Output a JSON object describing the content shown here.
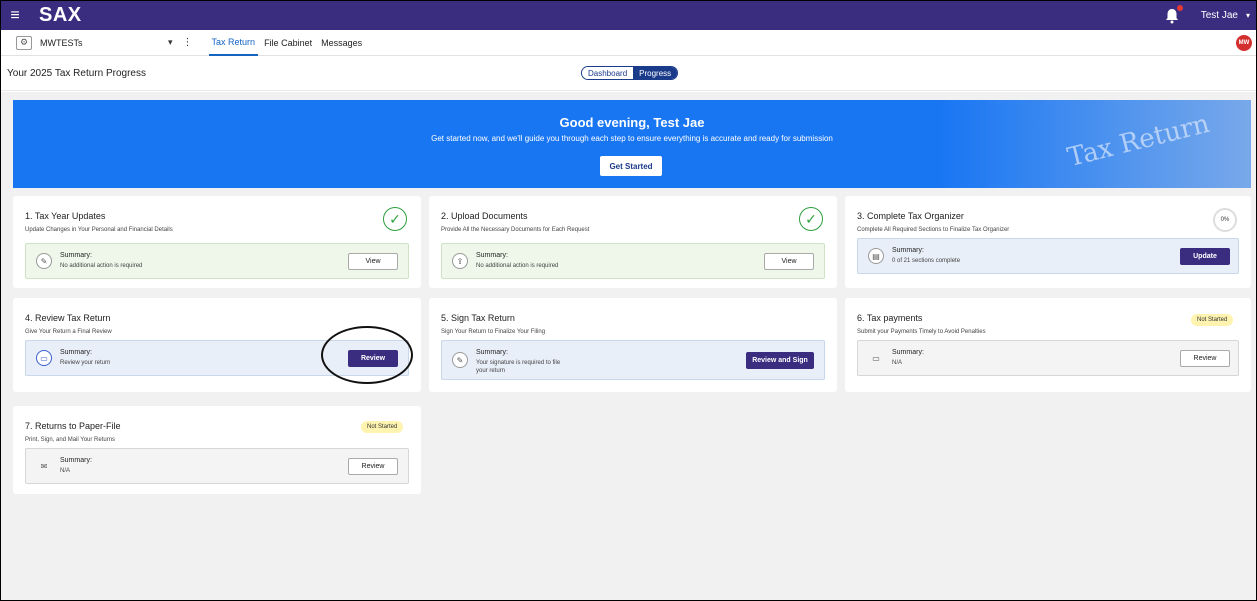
{
  "app": {
    "brand": "SAX",
    "user_name": "Test Jae",
    "avatar_initials": "MW"
  },
  "subbar": {
    "client_name": "MWTESTs",
    "tabs": [
      {
        "label": "Tax Return",
        "active": true
      },
      {
        "label": "File Cabinet",
        "active": false
      },
      {
        "label": "Messages",
        "active": false
      }
    ]
  },
  "header": {
    "title": "Your 2025 Tax Return Progress",
    "toggle": [
      "Dashboard",
      "Progress"
    ],
    "toggle_selected": "Progress"
  },
  "hero": {
    "greeting": "Good evening, Test Jae",
    "subtitle": "Get started now, and we'll guide you through each step to ensure everything is accurate and ready for submission",
    "button": "Get Started",
    "art_text": "Tax Return"
  },
  "cards": [
    {
      "title": "1. Tax Year Updates",
      "subtitle": "Update Changes in Your Personal and Financial Details",
      "summary_label": "Summary:",
      "summary_text": "No additional action is required",
      "button": "View",
      "status": "complete"
    },
    {
      "title": "2. Upload Documents",
      "subtitle": "Provide All the Necessary Documents for Each Request",
      "summary_label": "Summary:",
      "summary_text": "No additional action is required",
      "button": "View",
      "status": "complete"
    },
    {
      "title": "3. Complete Tax Organizer",
      "subtitle": "Complete All Required Sections to Finalize Tax Organizer",
      "summary_label": "Summary:",
      "summary_text": "0 of 21 sections complete",
      "button": "Update",
      "progress": "0%"
    },
    {
      "title": "4. Review Tax Return",
      "subtitle": "Give Your Return a Final Review",
      "summary_label": "Summary:",
      "summary_text": "Review your return",
      "button": "Review"
    },
    {
      "title": "5. Sign Tax Return",
      "subtitle": "Sign Your Return to Finalize Your Filing",
      "summary_label": "Summary:",
      "summary_text_1": "Your signature is required to file",
      "summary_text_2": "your return",
      "button": "Review and Sign"
    },
    {
      "title": "6. Tax payments",
      "subtitle": "Submit your Payments Timely to Avoid Penalties",
      "summary_label": "Summary:",
      "summary_text": "N/A",
      "button": "Review",
      "badge": "Not Started"
    },
    {
      "title": "7. Returns to Paper-File",
      "subtitle": "Print, Sign, and Mail Your Returns",
      "summary_label": "Summary:",
      "summary_text": "N/A",
      "button": "Review",
      "badge": "Not Started"
    }
  ],
  "colors": {
    "topbar": "#3a2d80",
    "hero": "#1976f3",
    "complete": "#2e9e3e",
    "badge": "#fff3b0"
  }
}
